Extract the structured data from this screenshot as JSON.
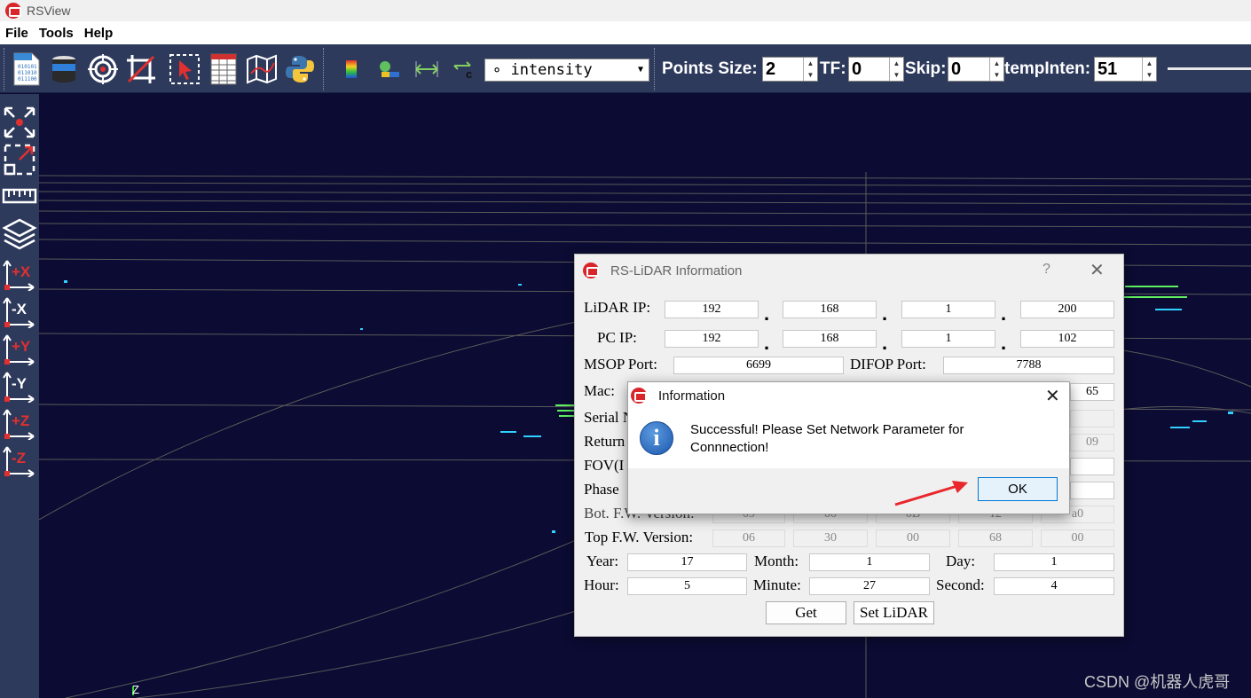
{
  "window": {
    "title": "RSView"
  },
  "menu": {
    "items": [
      "File",
      "Tools",
      "Help"
    ]
  },
  "toolbar": {
    "icons": [
      "binary-file-icon",
      "lidar-sensor-icon",
      "target-icon",
      "crop-icon",
      "select-points-icon",
      "spreadsheet-icon",
      "map-icon",
      "python-icon"
    ],
    "color_icons": [
      "color-scale-icon",
      "color-legend-icon",
      "scale-arrows-icon",
      "transform-arrows-icon"
    ],
    "color_by": "∘ intensity",
    "points_size_label": "Points Size:",
    "points_size": "2",
    "tf_label": "TF:",
    "tf": "0",
    "skip_label": "Skip:",
    "skip": "0",
    "temp_inten_label": "tempInten:",
    "temp_inten": "51"
  },
  "leftbar": {
    "icons": [
      "reset-view-icon",
      "zoom-box-icon",
      "ruler-icon",
      "layers-icon",
      "view-plus-x-icon",
      "view-minus-x-icon",
      "view-plus-y-icon",
      "view-minus-y-icon",
      "view-plus-z-icon",
      "view-minus-z-icon"
    ],
    "axis_labels": [
      "+X",
      "-X",
      "+Y",
      "-Y",
      "+Z",
      "-Z"
    ]
  },
  "viewport": {
    "axis_label": "Z"
  },
  "dialog": {
    "title": "RS-LiDAR Information",
    "help": "?",
    "close": "✕",
    "lidar_ip_label": "LiDAR IP:",
    "lidar_ip": [
      "192",
      "168",
      "1",
      "200"
    ],
    "pc_ip_label": "PC IP:",
    "pc_ip": [
      "192",
      "168",
      "1",
      "102"
    ],
    "msop_port_label": "MSOP Port:",
    "msop_port": "6699",
    "difop_port_label": "DIFOP Port:",
    "difop_port": "7788",
    "mac_label": "Mac:",
    "mac_last": "65",
    "serial_label": "Serial N",
    "return_label": "Return",
    "return_last": "09",
    "fov_label": "FOV(I",
    "phase_label": "Phase",
    "bot_fw_label": "Bot. F.W. Version:",
    "bot_fw": [
      "09",
      "00",
      "0B",
      "12",
      "a0"
    ],
    "top_fw_label": "Top  F.W. Version:",
    "top_fw": [
      "06",
      "30",
      "00",
      "68",
      "00"
    ],
    "year_label": "Year:",
    "year": "17",
    "month_label": "Month:",
    "month": "1",
    "day_label": "Day:",
    "day": "1",
    "hour_label": "Hour:",
    "hour": "5",
    "minute_label": "Minute:",
    "minute": "27",
    "second_label": "Second:",
    "second": "4",
    "get_button": "Get",
    "set_button": "Set LiDAR"
  },
  "info": {
    "title": "Information",
    "close": "✕",
    "message_line1": "Successful! Please Set Network Parameter for",
    "message_line2": "Connnection!",
    "ok": "OK"
  },
  "watermark": "CSDN @机器人虎哥",
  "colors": {
    "toolbar_bg": "#2e3a5c",
    "viewport_bg": "#0b0b33",
    "accent_red": "#d9262b",
    "ok_border": "#0078d7"
  }
}
